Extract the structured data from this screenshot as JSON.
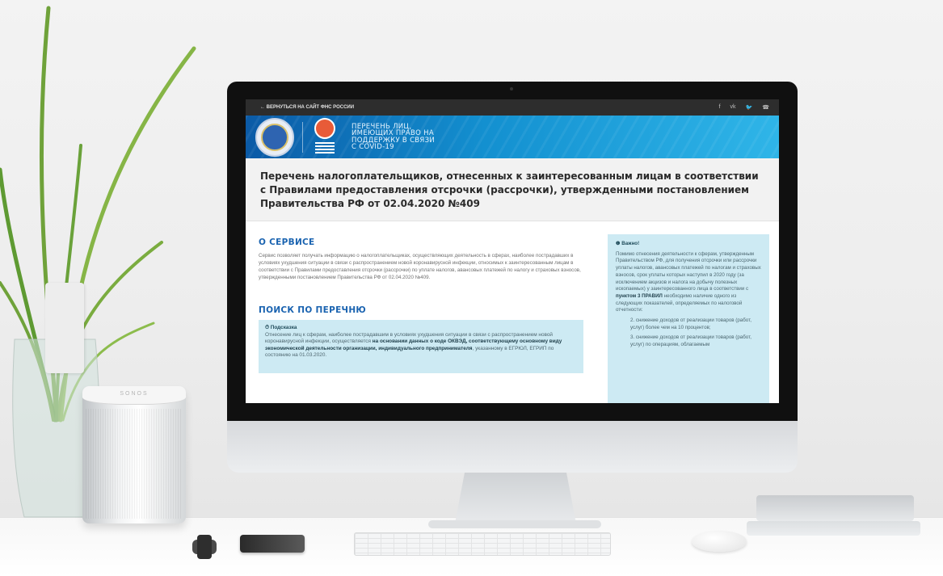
{
  "topbar": {
    "back_label": "← ВЕРНУТЬСЯ НА САЙТ ФНС РОССИИ",
    "social_icons": [
      "facebook-icon",
      "vk-icon",
      "twitter-icon",
      "phone-icon"
    ],
    "social_glyphs": [
      "f",
      "vk",
      "🐦",
      "☎"
    ]
  },
  "banner": {
    "title_line1": "ПЕРЕЧЕНЬ ЛИЦ,",
    "title_line2": "ИМЕЮЩИХ ПРАВО НА",
    "title_line3": "ПОДДЕРЖКУ В СВЯЗИ",
    "title_line4": "С COVID-19"
  },
  "heading": {
    "text": "Перечень налогоплательщиков, отнесенных к заинтересованным лицам в соответствии с Правилами предоставления отсрочки (рассрочки), утвержденными постановлением Правительства РФ от 02.04.2020 №409"
  },
  "about": {
    "title": "О СЕРВИСЕ",
    "text": "Сервис позволяет получать информацию о налогоплательщиках, осуществляющих деятельность в сферах, наиболее пострадавших в условиях ухудшения ситуации в связи с распространением новой коронавирусной инфекции, относимых к заинтересованным лицам в соответствии с Правилами предоставления отсрочки (рассрочки) по уплате налогов, авансовых платежей по налогу и страховых взносов, утвержденными постановлением Правительства РФ от 02.04.2020 №409."
  },
  "search": {
    "title": "ПОИСК ПО ПЕРЕЧНЮ",
    "hint_title": "⏱ Подсказка",
    "hint_text_1": "Отнесение лиц к сферам, наиболее пострадавшим в условиях ухудшения ситуации в связи с распространением новой коронавирусной инфекции, осуществляется ",
    "hint_bold": "на основании данных о коде ОКВЭД, соответствующему основному виду экономической деятельности организации, индивидуального предпринимателя",
    "hint_text_2": ", указанному в ЕГРЮЛ, ЕГРИП по состоянию на 01.03.2020."
  },
  "important": {
    "title": "❶ Важно!",
    "text_1": "Помимо отнесения деятельности к сферам, утвержденным Правительством РФ, для получения отсрочки или рассрочки уплаты налогов, авансовых платежей по налогам и страховых взносов, срок уплаты которых наступил в 2020 году (за исключением акцизов и налога на добычу полезных ископаемых) у заинтересованного лица в соответствии с ",
    "bold": "пунктом 3 ПРАВИЛ",
    "text_2": " необходимо наличие одного из следующих показателей, определяемых по налоговой отчетности:",
    "items": [
      "2. снижение доходов от реализации товаров (работ, услуг) более чем на 10 процентов;",
      "3. снижение доходов от реализации товаров (работ, услуг) по операциям, облагаемым"
    ]
  },
  "speaker": {
    "brand": "SONOS"
  },
  "colors": {
    "accent": "#1a63b0",
    "banner": "#1390d0",
    "info_box": "#cdeaf3"
  }
}
